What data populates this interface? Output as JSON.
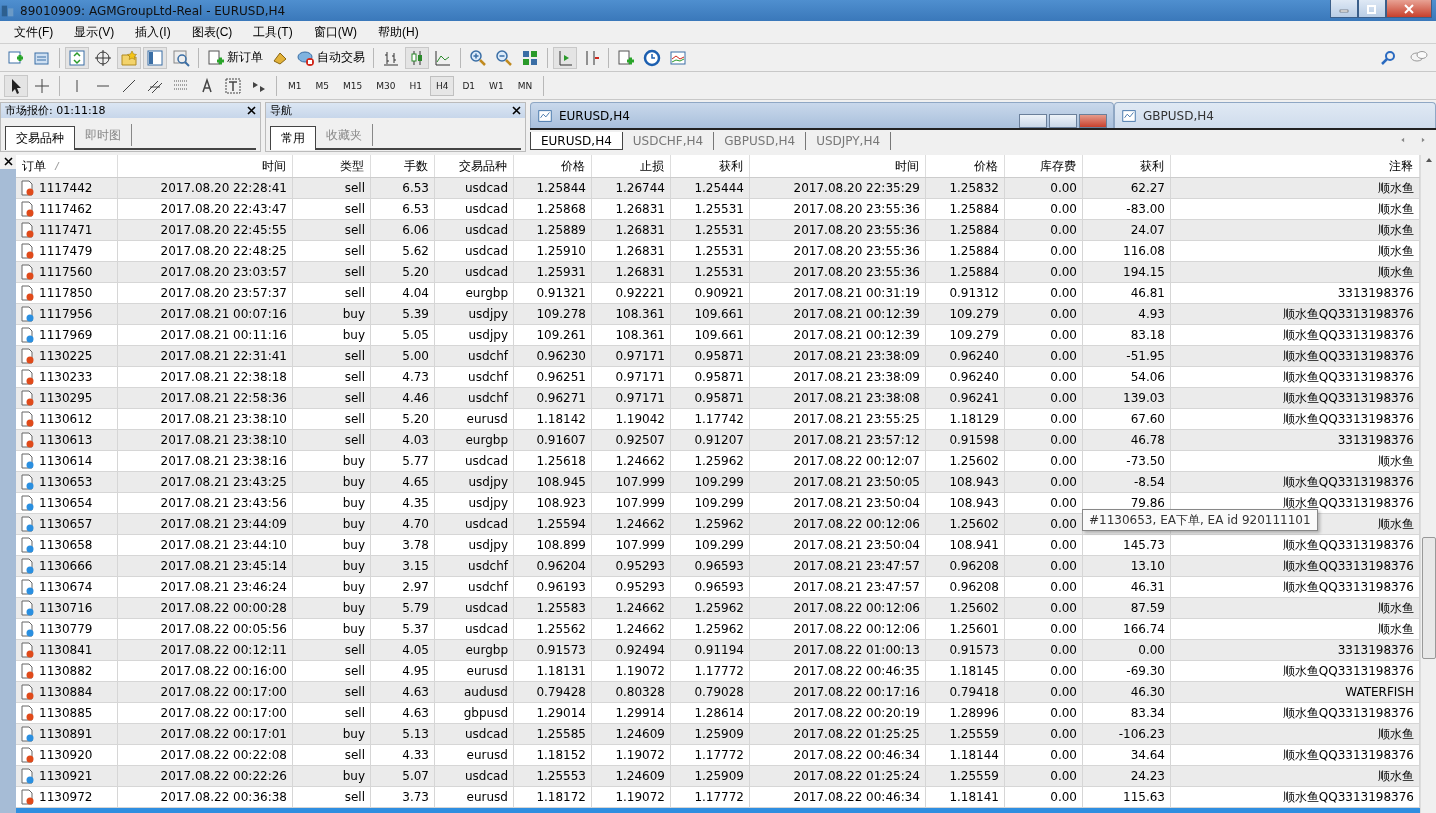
{
  "window": {
    "title": "89010909: AGMGroupLtd-Real - EURUSD,H4"
  },
  "menu": [
    "文件(F)",
    "显示(V)",
    "插入(I)",
    "图表(C)",
    "工具(T)",
    "窗口(W)",
    "帮助(H)"
  ],
  "toolbar": {
    "new_order": "新订单",
    "auto_trading": "自动交易"
  },
  "timeframes": [
    {
      "label": "M1",
      "selected": false
    },
    {
      "label": "M5",
      "selected": false
    },
    {
      "label": "M15",
      "selected": false
    },
    {
      "label": "M30",
      "selected": false
    },
    {
      "label": "H1",
      "selected": false
    },
    {
      "label": "H4",
      "selected": true
    },
    {
      "label": "D1",
      "selected": false
    },
    {
      "label": "W1",
      "selected": false
    },
    {
      "label": "MN",
      "selected": false
    }
  ],
  "market_watch": {
    "title": "市场报价: 01:11:18",
    "tabs": [
      {
        "label": "交易品种",
        "selected": true
      },
      {
        "label": "即时图",
        "selected": false
      }
    ]
  },
  "navigator": {
    "title": "导航",
    "tabs": [
      {
        "label": "常用",
        "selected": true
      },
      {
        "label": "收藏夹",
        "selected": false
      }
    ]
  },
  "chart_windows": [
    {
      "title": "EURUSD,H4",
      "active": true
    },
    {
      "title": "GBPUSD,H4",
      "active": false
    }
  ],
  "chart_tabs": [
    {
      "label": "EURUSD,H4",
      "selected": true
    },
    {
      "label": "USDCHF,H4",
      "selected": false
    },
    {
      "label": "GBPUSD,H4",
      "selected": false
    },
    {
      "label": "USDJPY,H4",
      "selected": false
    }
  ],
  "table": {
    "columns": [
      "订单",
      "时间",
      "类型",
      "手数",
      "交易品种",
      "价格",
      "止损",
      "获利",
      "时间",
      "价格",
      "库存费",
      "获利",
      "注释"
    ],
    "rows": [
      {
        "kind": "sell",
        "order": "1117442",
        "open_time": "2017.08.20 22:28:41",
        "type": "sell",
        "lots": "6.53",
        "symbol": "usdcad",
        "price": "1.25844",
        "sl": "1.26744",
        "tp": "1.25444",
        "close_time": "2017.08.20 22:35:29",
        "close_price": "1.25832",
        "swap": "0.00",
        "profit": "62.27",
        "comment": "顺水鱼"
      },
      {
        "kind": "sell",
        "order": "1117462",
        "open_time": "2017.08.20 22:43:47",
        "type": "sell",
        "lots": "6.53",
        "symbol": "usdcad",
        "price": "1.25868",
        "sl": "1.26831",
        "tp": "1.25531",
        "close_time": "2017.08.20 23:55:36",
        "close_price": "1.25884",
        "swap": "0.00",
        "profit": "-83.00",
        "comment": "顺水鱼"
      },
      {
        "kind": "sell",
        "order": "1117471",
        "open_time": "2017.08.20 22:45:55",
        "type": "sell",
        "lots": "6.06",
        "symbol": "usdcad",
        "price": "1.25889",
        "sl": "1.26831",
        "tp": "1.25531",
        "close_time": "2017.08.20 23:55:36",
        "close_price": "1.25884",
        "swap": "0.00",
        "profit": "24.07",
        "comment": "顺水鱼"
      },
      {
        "kind": "sell",
        "order": "1117479",
        "open_time": "2017.08.20 22:48:25",
        "type": "sell",
        "lots": "5.62",
        "symbol": "usdcad",
        "price": "1.25910",
        "sl": "1.26831",
        "tp": "1.25531",
        "close_time": "2017.08.20 23:55:36",
        "close_price": "1.25884",
        "swap": "0.00",
        "profit": "116.08",
        "comment": "顺水鱼"
      },
      {
        "kind": "sell",
        "order": "1117560",
        "open_time": "2017.08.20 23:03:57",
        "type": "sell",
        "lots": "5.20",
        "symbol": "usdcad",
        "price": "1.25931",
        "sl": "1.26831",
        "tp": "1.25531",
        "close_time": "2017.08.20 23:55:36",
        "close_price": "1.25884",
        "swap": "0.00",
        "profit": "194.15",
        "comment": "顺水鱼"
      },
      {
        "kind": "sell",
        "order": "1117850",
        "open_time": "2017.08.20 23:57:37",
        "type": "sell",
        "lots": "4.04",
        "symbol": "eurgbp",
        "price": "0.91321",
        "sl": "0.92221",
        "tp": "0.90921",
        "close_time": "2017.08.21 00:31:19",
        "close_price": "0.91312",
        "swap": "0.00",
        "profit": "46.81",
        "comment": "3313198376"
      },
      {
        "kind": "buy",
        "order": "1117956",
        "open_time": "2017.08.21 00:07:16",
        "type": "buy",
        "lots": "5.39",
        "symbol": "usdjpy",
        "price": "109.278",
        "sl": "108.361",
        "tp": "109.661",
        "close_time": "2017.08.21 00:12:39",
        "close_price": "109.279",
        "swap": "0.00",
        "profit": "4.93",
        "comment": "顺水鱼QQ3313198376"
      },
      {
        "kind": "buy",
        "order": "1117969",
        "open_time": "2017.08.21 00:11:16",
        "type": "buy",
        "lots": "5.05",
        "symbol": "usdjpy",
        "price": "109.261",
        "sl": "108.361",
        "tp": "109.661",
        "close_time": "2017.08.21 00:12:39",
        "close_price": "109.279",
        "swap": "0.00",
        "profit": "83.18",
        "comment": "顺水鱼QQ3313198376"
      },
      {
        "kind": "sell",
        "order": "1130225",
        "open_time": "2017.08.21 22:31:41",
        "type": "sell",
        "lots": "5.00",
        "symbol": "usdchf",
        "price": "0.96230",
        "sl": "0.97171",
        "tp": "0.95871",
        "close_time": "2017.08.21 23:38:09",
        "close_price": "0.96240",
        "swap": "0.00",
        "profit": "-51.95",
        "comment": "顺水鱼QQ3313198376"
      },
      {
        "kind": "sell",
        "order": "1130233",
        "open_time": "2017.08.21 22:38:18",
        "type": "sell",
        "lots": "4.73",
        "symbol": "usdchf",
        "price": "0.96251",
        "sl": "0.97171",
        "tp": "0.95871",
        "close_time": "2017.08.21 23:38:09",
        "close_price": "0.96240",
        "swap": "0.00",
        "profit": "54.06",
        "comment": "顺水鱼QQ3313198376"
      },
      {
        "kind": "sell",
        "order": "1130295",
        "open_time": "2017.08.21 22:58:36",
        "type": "sell",
        "lots": "4.46",
        "symbol": "usdchf",
        "price": "0.96271",
        "sl": "0.97171",
        "tp": "0.95871",
        "close_time": "2017.08.21 23:38:08",
        "close_price": "0.96241",
        "swap": "0.00",
        "profit": "139.03",
        "comment": "顺水鱼QQ3313198376"
      },
      {
        "kind": "sell",
        "order": "1130612",
        "open_time": "2017.08.21 23:38:10",
        "type": "sell",
        "lots": "5.20",
        "symbol": "eurusd",
        "price": "1.18142",
        "sl": "1.19042",
        "tp": "1.17742",
        "close_time": "2017.08.21 23:55:25",
        "close_price": "1.18129",
        "swap": "0.00",
        "profit": "67.60",
        "comment": "顺水鱼QQ3313198376"
      },
      {
        "kind": "sell",
        "order": "1130613",
        "open_time": "2017.08.21 23:38:10",
        "type": "sell",
        "lots": "4.03",
        "symbol": "eurgbp",
        "price": "0.91607",
        "sl": "0.92507",
        "tp": "0.91207",
        "close_time": "2017.08.21 23:57:12",
        "close_price": "0.91598",
        "swap": "0.00",
        "profit": "46.78",
        "comment": "3313198376"
      },
      {
        "kind": "buy",
        "order": "1130614",
        "open_time": "2017.08.21 23:38:16",
        "type": "buy",
        "lots": "5.77",
        "symbol": "usdcad",
        "price": "1.25618",
        "sl": "1.24662",
        "tp": "1.25962",
        "close_time": "2017.08.22 00:12:07",
        "close_price": "1.25602",
        "swap": "0.00",
        "profit": "-73.50",
        "comment": "顺水鱼"
      },
      {
        "kind": "buy",
        "order": "1130653",
        "open_time": "2017.08.21 23:43:25",
        "type": "buy",
        "lots": "4.65",
        "symbol": "usdjpy",
        "price": "108.945",
        "sl": "107.999",
        "tp": "109.299",
        "close_time": "2017.08.21 23:50:05",
        "close_price": "108.943",
        "swap": "0.00",
        "profit": "-8.54",
        "comment": "顺水鱼QQ3313198376"
      },
      {
        "kind": "buy",
        "order": "1130654",
        "open_time": "2017.08.21 23:43:56",
        "type": "buy",
        "lots": "4.35",
        "symbol": "usdjpy",
        "price": "108.923",
        "sl": "107.999",
        "tp": "109.299",
        "close_time": "2017.08.21 23:50:04",
        "close_price": "108.943",
        "swap": "0.00",
        "profit": "79.86",
        "comment": "顺水鱼QQ3313198376"
      },
      {
        "kind": "buy",
        "order": "1130657",
        "open_time": "2017.08.21 23:44:09",
        "type": "buy",
        "lots": "4.70",
        "symbol": "usdcad",
        "price": "1.25594",
        "sl": "1.24662",
        "tp": "1.25962",
        "close_time": "2017.08.22 00:12:06",
        "close_price": "1.25602",
        "swap": "0.00",
        "comment": "顺水鱼",
        "tooltip": "#1130653, EA下单, EA id 920111101"
      },
      {
        "kind": "buy",
        "order": "1130658",
        "open_time": "2017.08.21 23:44:10",
        "type": "buy",
        "lots": "3.78",
        "symbol": "usdjpy",
        "price": "108.899",
        "sl": "107.999",
        "tp": "109.299",
        "close_time": "2017.08.21 23:50:04",
        "close_price": "108.941",
        "swap": "0.00",
        "profit": "145.73",
        "comment": "顺水鱼QQ3313198376"
      },
      {
        "kind": "buy",
        "order": "1130666",
        "open_time": "2017.08.21 23:45:14",
        "type": "buy",
        "lots": "3.15",
        "symbol": "usdchf",
        "price": "0.96204",
        "sl": "0.95293",
        "tp": "0.96593",
        "close_time": "2017.08.21 23:47:57",
        "close_price": "0.96208",
        "swap": "0.00",
        "profit": "13.10",
        "comment": "顺水鱼QQ3313198376"
      },
      {
        "kind": "buy",
        "order": "1130674",
        "open_time": "2017.08.21 23:46:24",
        "type": "buy",
        "lots": "2.97",
        "symbol": "usdchf",
        "price": "0.96193",
        "sl": "0.95293",
        "tp": "0.96593",
        "close_time": "2017.08.21 23:47:57",
        "close_price": "0.96208",
        "swap": "0.00",
        "profit": "46.31",
        "comment": "顺水鱼QQ3313198376"
      },
      {
        "kind": "buy",
        "order": "1130716",
        "open_time": "2017.08.22 00:00:28",
        "type": "buy",
        "lots": "5.79",
        "symbol": "usdcad",
        "price": "1.25583",
        "sl": "1.24662",
        "tp": "1.25962",
        "close_time": "2017.08.22 00:12:06",
        "close_price": "1.25602",
        "swap": "0.00",
        "profit": "87.59",
        "comment": "顺水鱼"
      },
      {
        "kind": "buy",
        "order": "1130779",
        "open_time": "2017.08.22 00:05:56",
        "type": "buy",
        "lots": "5.37",
        "symbol": "usdcad",
        "price": "1.25562",
        "sl": "1.24662",
        "tp": "1.25962",
        "close_time": "2017.08.22 00:12:06",
        "close_price": "1.25601",
        "swap": "0.00",
        "profit": "166.74",
        "comment": "顺水鱼"
      },
      {
        "kind": "sell",
        "order": "1130841",
        "open_time": "2017.08.22 00:12:11",
        "type": "sell",
        "lots": "4.05",
        "symbol": "eurgbp",
        "price": "0.91573",
        "sl": "0.92494",
        "tp": "0.91194",
        "close_time": "2017.08.22 01:00:13",
        "close_price": "0.91573",
        "swap": "0.00",
        "profit": "0.00",
        "comment": "3313198376"
      },
      {
        "kind": "sell",
        "order": "1130882",
        "open_time": "2017.08.22 00:16:00",
        "type": "sell",
        "lots": "4.95",
        "symbol": "eurusd",
        "price": "1.18131",
        "sl": "1.19072",
        "tp": "1.17772",
        "close_time": "2017.08.22 00:46:35",
        "close_price": "1.18145",
        "swap": "0.00",
        "profit": "-69.30",
        "comment": "顺水鱼QQ3313198376"
      },
      {
        "kind": "sell",
        "order": "1130884",
        "open_time": "2017.08.22 00:17:00",
        "type": "sell",
        "lots": "4.63",
        "symbol": "audusd",
        "price": "0.79428",
        "sl": "0.80328",
        "tp": "0.79028",
        "close_time": "2017.08.22 00:17:16",
        "close_price": "0.79418",
        "swap": "0.00",
        "profit": "46.30",
        "comment": "WATERFISH"
      },
      {
        "kind": "sell",
        "order": "1130885",
        "open_time": "2017.08.22 00:17:00",
        "type": "sell",
        "lots": "4.63",
        "symbol": "gbpusd",
        "price": "1.29014",
        "sl": "1.29914",
        "tp": "1.28614",
        "close_time": "2017.08.22 00:20:19",
        "close_price": "1.28996",
        "swap": "0.00",
        "profit": "83.34",
        "comment": "顺水鱼QQ3313198376"
      },
      {
        "kind": "buy",
        "order": "1130891",
        "open_time": "2017.08.22 00:17:01",
        "type": "buy",
        "lots": "5.13",
        "symbol": "usdcad",
        "price": "1.25585",
        "sl": "1.24609",
        "tp": "1.25909",
        "close_time": "2017.08.22 01:25:25",
        "close_price": "1.25559",
        "swap": "0.00",
        "profit": "-106.23",
        "comment": "顺水鱼"
      },
      {
        "kind": "sell",
        "order": "1130920",
        "open_time": "2017.08.22 00:22:08",
        "type": "sell",
        "lots": "4.33",
        "symbol": "eurusd",
        "price": "1.18152",
        "sl": "1.19072",
        "tp": "1.17772",
        "close_time": "2017.08.22 00:46:34",
        "close_price": "1.18144",
        "swap": "0.00",
        "profit": "34.64",
        "comment": "顺水鱼QQ3313198376"
      },
      {
        "kind": "buy",
        "order": "1130921",
        "open_time": "2017.08.22 00:22:26",
        "type": "buy",
        "lots": "5.07",
        "symbol": "usdcad",
        "price": "1.25553",
        "sl": "1.24609",
        "tp": "1.25909",
        "close_time": "2017.08.22 01:25:24",
        "close_price": "1.25559",
        "swap": "0.00",
        "profit": "24.23",
        "comment": "顺水鱼"
      },
      {
        "kind": "sell",
        "order": "1130972",
        "open_time": "2017.08.22 00:36:38",
        "type": "sell",
        "lots": "3.73",
        "symbol": "eurusd",
        "price": "1.18172",
        "sl": "1.19072",
        "tp": "1.17772",
        "close_time": "2017.08.22 00:46:34",
        "close_price": "1.18141",
        "swap": "0.00",
        "profit": "115.63",
        "comment": "顺水鱼QQ3313198376"
      }
    ]
  }
}
